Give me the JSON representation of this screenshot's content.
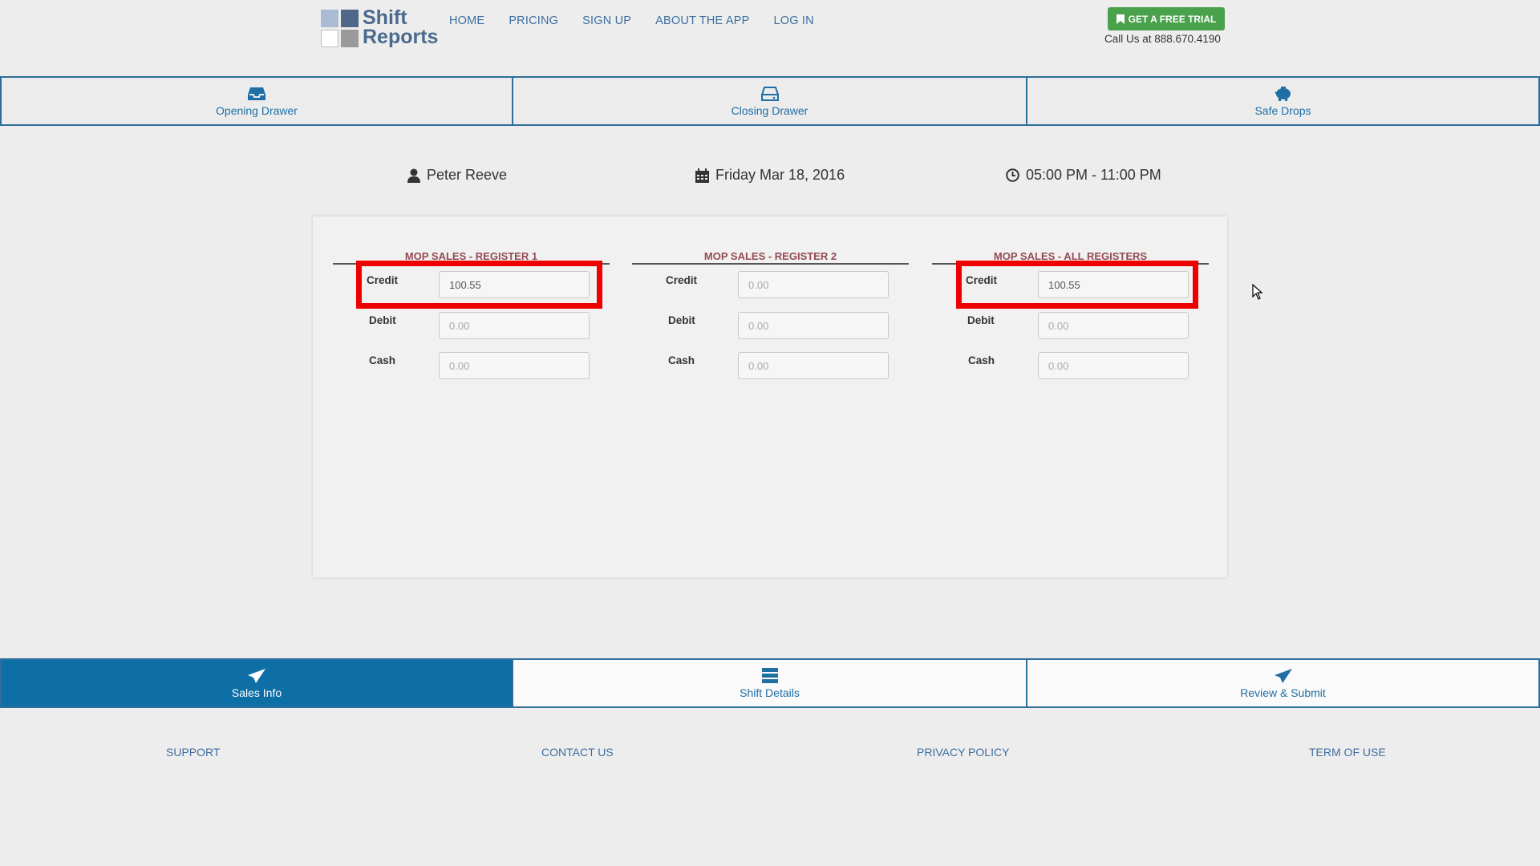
{
  "header": {
    "logo_line1": "Shift",
    "logo_line2": "Reports",
    "nav": [
      "HOME",
      "PRICING",
      "SIGN UP",
      "ABOUT THE APP",
      "LOG IN"
    ],
    "trial_button": "GET A FREE TRIAL",
    "call_text": "Call Us at 888.670.4190"
  },
  "top_tabs": [
    "Opening Drawer",
    "Closing Drawer",
    "Safe Drops"
  ],
  "shift_info": {
    "employee": "Peter Reeve",
    "date": "Friday Mar 18, 2016",
    "time": "05:00 PM - 11:00 PM"
  },
  "registers": [
    {
      "title": "MOP SALES - REGISTER 1",
      "fields": [
        {
          "label": "Credit",
          "value": "100.55",
          "placeholder": "0.00"
        },
        {
          "label": "Debit",
          "value": "",
          "placeholder": "0.00"
        },
        {
          "label": "Cash",
          "value": "",
          "placeholder": "0.00"
        }
      ]
    },
    {
      "title": "MOP SALES - REGISTER 2",
      "fields": [
        {
          "label": "Credit",
          "value": "",
          "placeholder": "0.00"
        },
        {
          "label": "Debit",
          "value": "",
          "placeholder": "0.00"
        },
        {
          "label": "Cash",
          "value": "",
          "placeholder": "0.00"
        }
      ]
    },
    {
      "title": "MOP SALES - ALL REGISTERS",
      "fields": [
        {
          "label": "Credit",
          "value": "100.55",
          "placeholder": "0.00"
        },
        {
          "label": "Debit",
          "value": "",
          "placeholder": "0.00"
        },
        {
          "label": "Cash",
          "value": "",
          "placeholder": "0.00"
        }
      ]
    }
  ],
  "bottom_tabs": [
    "Sales Info",
    "Shift Details",
    "Review & Submit"
  ],
  "footer": [
    "SUPPORT",
    "CONTACT US",
    "PRIVACY POLICY",
    "TERM OF USE"
  ],
  "colors": {
    "accent": "#0d6fa5",
    "trial_green": "#4aa14b",
    "highlight_red": "#ee0000",
    "register_title": "#944a55"
  }
}
